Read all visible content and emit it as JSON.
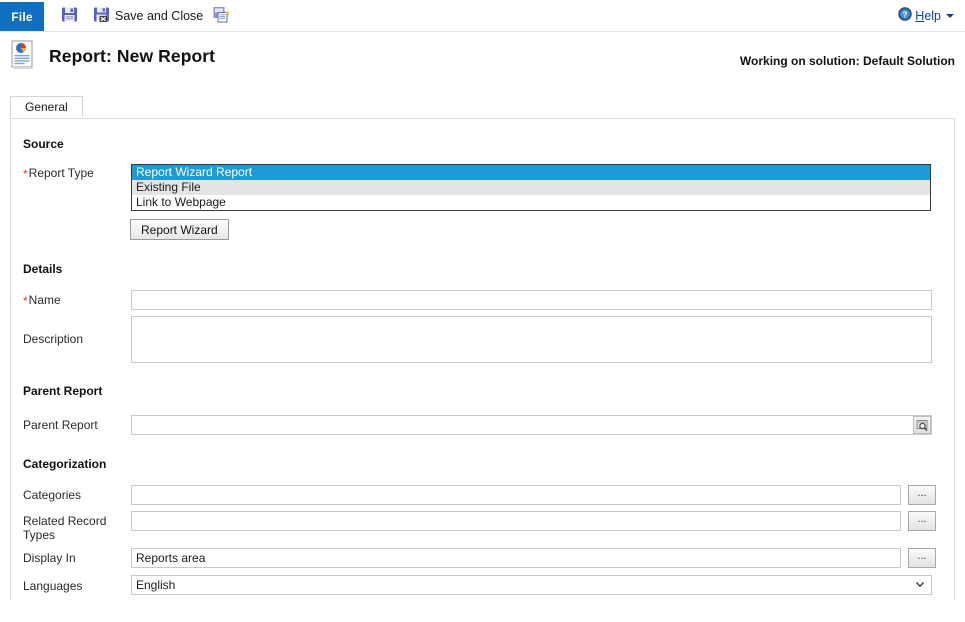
{
  "ribbon": {
    "file_tab": "File",
    "commands": [
      {
        "icon": "save-icon",
        "label": ""
      },
      {
        "icon": "save-and-close-icon",
        "label": "Save and Close"
      },
      {
        "icon": "save-as-new-icon",
        "label": ""
      }
    ],
    "help": {
      "label_pre": "",
      "label_accel": "H",
      "label_post": "elp",
      "icon": "help-icon"
    }
  },
  "header": {
    "icon": "report-document-icon",
    "title": "Report: New Report",
    "solution": "Working on solution: Default Solution"
  },
  "tabs": [
    {
      "label": "General",
      "active": true
    }
  ],
  "form": {
    "sections": [
      {
        "name": "source",
        "heading": "Source",
        "report_type": {
          "label": "Report Type",
          "required": true,
          "options": [
            {
              "label": "Report Wizard Report",
              "selected": true
            },
            {
              "label": "Existing File",
              "selected": false
            },
            {
              "label": "Link to Webpage",
              "selected": false
            }
          ]
        },
        "wizard_button": "Report Wizard"
      },
      {
        "name": "details",
        "heading": "Details",
        "name_field": {
          "label": "Name",
          "required": true,
          "value": "",
          "placeholder": ""
        },
        "description_field": {
          "label": "Description",
          "required": false,
          "value": "",
          "placeholder": ""
        }
      },
      {
        "name": "parent_report",
        "heading": "Parent Report",
        "parent_field": {
          "label": "Parent Report",
          "required": false,
          "value": "",
          "placeholder": "",
          "lookup_icon": "lookup-icon"
        }
      },
      {
        "name": "categorization",
        "heading": "Categorization",
        "categories": {
          "label": "Categories",
          "value": "",
          "button": "..."
        },
        "related_record_types": {
          "label": "Related Record Types",
          "value": "",
          "button": "..."
        },
        "display_in": {
          "label": "Display In",
          "value": "Reports area",
          "button": "..."
        },
        "languages": {
          "label": "Languages",
          "value": "English",
          "options": [
            "English"
          ]
        }
      }
    ]
  },
  "colors": {
    "file_tab_blue": "#0f6fc0",
    "selection_blue": "#1e9bd7",
    "required_red": "#e03a1e",
    "help_link": "#15447e",
    "border_gray": "#c8c8c8"
  }
}
